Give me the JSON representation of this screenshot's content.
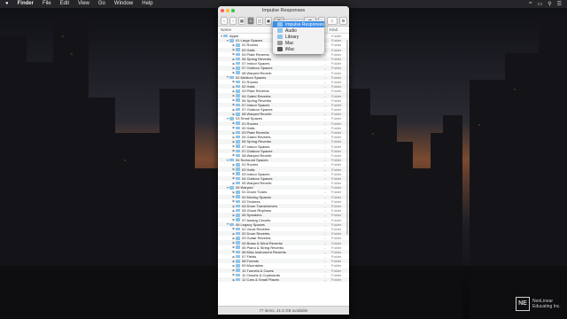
{
  "menubar": {
    "items": [
      "Finder",
      "File",
      "Edit",
      "View",
      "Go",
      "Window",
      "Help"
    ]
  },
  "window": {
    "title": "Impulse Responses",
    "columns": {
      "name": "Name",
      "kind": "Kind"
    },
    "status": "77 items, 41.5 GB available"
  },
  "popup": {
    "items": [
      "Impulse Responses",
      "Audio",
      "Library",
      "Mac",
      "iMac"
    ]
  },
  "rows": [
    {
      "label": "Apple",
      "depth": 0,
      "open": true,
      "dash": "",
      "kind": "Folder"
    },
    {
      "label": "01 Large Spaces",
      "depth": 1,
      "open": true,
      "dash": "--",
      "kind": "Folder"
    },
    {
      "label": "01 Rooms",
      "depth": 2,
      "open": false,
      "dash": "--",
      "kind": "Folder"
    },
    {
      "label": "02 Halls",
      "depth": 2,
      "open": false,
      "dash": "--",
      "kind": "Folder"
    },
    {
      "label": "03 Plate Reverbs",
      "depth": 2,
      "open": false,
      "dash": "--",
      "kind": "Folder"
    },
    {
      "label": "06 Spring Reverbs",
      "depth": 2,
      "open": false,
      "dash": "--",
      "kind": "Folder"
    },
    {
      "label": "07 Indoor Spaces",
      "depth": 2,
      "open": false,
      "dash": "--",
      "kind": "Folder"
    },
    {
      "label": "07 Outdoor Spaces",
      "depth": 2,
      "open": false,
      "dash": "--",
      "kind": "Folder"
    },
    {
      "label": "08 Warped Reverb",
      "depth": 2,
      "open": false,
      "dash": "--",
      "kind": "Folder"
    },
    {
      "label": "02 Medium Spaces",
      "depth": 1,
      "open": true,
      "dash": "--",
      "kind": "Folder"
    },
    {
      "label": "01 Rooms",
      "depth": 2,
      "open": false,
      "dash": "--",
      "kind": "Folder"
    },
    {
      "label": "02 Halls",
      "depth": 2,
      "open": false,
      "dash": "--",
      "kind": "Folder"
    },
    {
      "label": "03 Plate Reverbs",
      "depth": 2,
      "open": false,
      "dash": "--",
      "kind": "Folder"
    },
    {
      "label": "04 Gated Reverbs",
      "depth": 2,
      "open": false,
      "dash": "--",
      "kind": "Folder"
    },
    {
      "label": "06 Spring Reverbs",
      "depth": 2,
      "open": false,
      "dash": "--",
      "kind": "Folder"
    },
    {
      "label": "07 Indoor Spaces",
      "depth": 2,
      "open": false,
      "dash": "--",
      "kind": "Folder"
    },
    {
      "label": "07 Outdoor Spaces",
      "depth": 2,
      "open": false,
      "dash": "--",
      "kind": "Folder"
    },
    {
      "label": "08 Warped Reverb",
      "depth": 2,
      "open": false,
      "dash": "--",
      "kind": "Folder"
    },
    {
      "label": "03 Small Spaces",
      "depth": 1,
      "open": true,
      "dash": "--",
      "kind": "Folder"
    },
    {
      "label": "01 Rooms",
      "depth": 2,
      "open": false,
      "dash": "--",
      "kind": "Folder"
    },
    {
      "label": "02 Halls",
      "depth": 2,
      "open": false,
      "dash": "--",
      "kind": "Folder"
    },
    {
      "label": "03 Plate Reverbs",
      "depth": 2,
      "open": false,
      "dash": "--",
      "kind": "Folder"
    },
    {
      "label": "04 Gated Reverbs",
      "depth": 2,
      "open": false,
      "dash": "--",
      "kind": "Folder"
    },
    {
      "label": "06 Spring Reverbs",
      "depth": 2,
      "open": false,
      "dash": "--",
      "kind": "Folder"
    },
    {
      "label": "07 Indoor Spaces",
      "depth": 2,
      "open": false,
      "dash": "--",
      "kind": "Folder"
    },
    {
      "label": "07 Outdoor Spaces",
      "depth": 2,
      "open": false,
      "dash": "--",
      "kind": "Folder"
    },
    {
      "label": "08 Warped Reverb",
      "depth": 2,
      "open": false,
      "dash": "--",
      "kind": "Folder"
    },
    {
      "label": "04 Surround Spaces",
      "depth": 1,
      "open": true,
      "dash": "--",
      "kind": "Folder"
    },
    {
      "label": "01 Rooms",
      "depth": 2,
      "open": false,
      "dash": "--",
      "kind": "Folder"
    },
    {
      "label": "02 Halls",
      "depth": 2,
      "open": false,
      "dash": "--",
      "kind": "Folder"
    },
    {
      "label": "03 Indoor Spaces",
      "depth": 2,
      "open": false,
      "dash": "--",
      "kind": "Folder"
    },
    {
      "label": "04 Outdoor Spaces",
      "depth": 2,
      "open": false,
      "dash": "--",
      "kind": "Folder"
    },
    {
      "label": "05 Warped Reverb",
      "depth": 2,
      "open": false,
      "dash": "--",
      "kind": "Folder"
    },
    {
      "label": "05 Warped",
      "depth": 1,
      "open": true,
      "dash": "--",
      "kind": "Folder"
    },
    {
      "label": "01 Drone Tones",
      "depth": 2,
      "open": false,
      "dash": "--",
      "kind": "Folder"
    },
    {
      "label": "02 Moving Spaces",
      "depth": 2,
      "open": false,
      "dash": "--",
      "kind": "Folder"
    },
    {
      "label": "03 Textures",
      "depth": 2,
      "open": false,
      "dash": "--",
      "kind": "Folder"
    },
    {
      "label": "04 Drum Transformers",
      "depth": 2,
      "open": false,
      "dash": "--",
      "kind": "Folder"
    },
    {
      "label": "05 Ghost Rhythms",
      "depth": 2,
      "open": false,
      "dash": "--",
      "kind": "Folder"
    },
    {
      "label": "06 Speakers",
      "depth": 2,
      "open": false,
      "dash": "--",
      "kind": "Folder"
    },
    {
      "label": "07 Analog Circuits",
      "depth": 2,
      "open": false,
      "dash": "--",
      "kind": "Folder"
    },
    {
      "label": "06 Legacy Spaces",
      "depth": 1,
      "open": true,
      "dash": "--",
      "kind": "Folder"
    },
    {
      "label": "01 Vocal Reverbs",
      "depth": 2,
      "open": false,
      "dash": "--",
      "kind": "Folder"
    },
    {
      "label": "02 Drum Reverbs",
      "depth": 2,
      "open": false,
      "dash": "--",
      "kind": "Folder"
    },
    {
      "label": "03 Guitar Reverbs",
      "depth": 2,
      "open": false,
      "dash": "--",
      "kind": "Folder"
    },
    {
      "label": "04 Brass & Wind Reverbs",
      "depth": 2,
      "open": false,
      "dash": "--",
      "kind": "Folder"
    },
    {
      "label": "05 Piano & String Reverbs",
      "depth": 2,
      "open": false,
      "dash": "--",
      "kind": "Folder"
    },
    {
      "label": "06 Misc Instrument Reverbs",
      "depth": 2,
      "open": false,
      "dash": "--",
      "kind": "Folder"
    },
    {
      "label": "07 Fields",
      "depth": 2,
      "open": false,
      "dash": "--",
      "kind": "Folder"
    },
    {
      "label": "08 Forests",
      "depth": 2,
      "open": false,
      "dash": "--",
      "kind": "Folder"
    },
    {
      "label": "09 Mountains",
      "depth": 2,
      "open": false,
      "dash": "--",
      "kind": "Folder"
    },
    {
      "label": "10 Tunnels & Caves",
      "depth": 2,
      "open": false,
      "dash": "--",
      "kind": "Folder"
    },
    {
      "label": "11 Closets & Cupboards",
      "depth": 2,
      "open": false,
      "dash": "--",
      "kind": "Folder"
    },
    {
      "label": "12 Cars & Small Places",
      "depth": 2,
      "open": false,
      "dash": "--",
      "kind": "Folder"
    }
  ],
  "logo": {
    "mark": "NE",
    "line1": "NonLinear",
    "line2": "Educating Inc."
  },
  "colors": {
    "selection": "#3d8ee9",
    "folder": "#8ec4ea",
    "close": "#fc5f57",
    "minimize": "#fdbc2e",
    "zoom": "#33c748"
  }
}
